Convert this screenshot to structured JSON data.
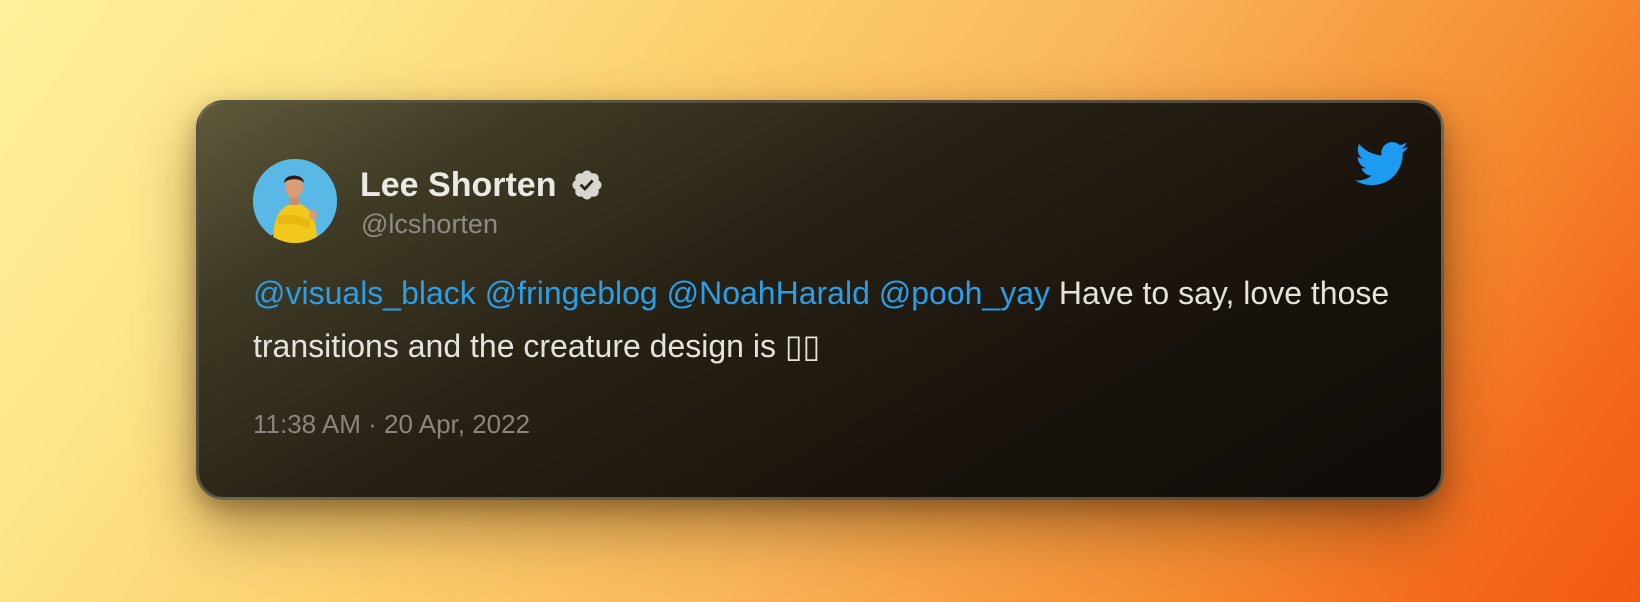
{
  "tweet": {
    "author_name": "Lee Shorten",
    "author_handle": "@lcshorten",
    "mentions": [
      "@visuals_black",
      "@fringeblog",
      "@NoahHarald",
      "@pooh_yay"
    ],
    "body_text": "Have to say, love those transitions and the creature design is ▯▯",
    "timestamp": "11:38 AM · 20 Apr, 2022",
    "verified_icon": "verified-badge-icon",
    "platform_icon": "twitter-bird-icon"
  },
  "colors": {
    "mention": "#2a9ee8",
    "twitter_blue": "#1d9bf0",
    "name": "#ece9e3",
    "muted": "#8f8c83"
  }
}
